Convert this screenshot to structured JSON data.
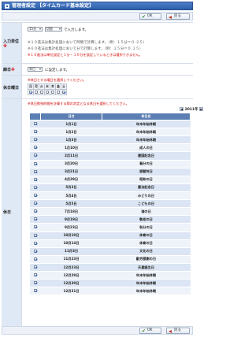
{
  "header": {
    "title": "管理者設定 【タイムカード基本設定】"
  },
  "toolbar": {
    "ok_label": "OK",
    "back_label": "戻る"
  },
  "input_unit": {
    "label": "入力単位",
    "hours_value": "15分",
    "method_value": "切捨",
    "suffix": "で入力します。",
    "note1": "※１０進法は集計処理において時間で計算します。（例：１５分＝０.２５）",
    "note2": "※６０進法は集計処理において分で計算します。（例：１５分＝０.１５）",
    "note3": "※１０進法は単位設定と１分・１０分を設定しているときは選択できません。"
  },
  "close_day": {
    "label": "締日",
    "value": "末日",
    "suffix": "に設定します。"
  },
  "holiday_dow": {
    "label": "休日曜日",
    "note": "※休日とする曜日を選択してください。",
    "days": [
      "日",
      "月",
      "火",
      "水",
      "木",
      "金",
      "土"
    ],
    "checked": [
      true,
      false,
      false,
      false,
      false,
      false,
      true
    ]
  },
  "holiday": {
    "label": "休日",
    "note": "※休日数残時間を計算する際の判定となる休日を選択してください。",
    "year": "2011年",
    "prev": "◀",
    "next": "▶",
    "columns": [
      "",
      "日付",
      "休日名"
    ],
    "rows": [
      {
        "date": "1月1日",
        "name": "年末年始休暇",
        "checked": true
      },
      {
        "date": "1月2日",
        "name": "年末年始休暇",
        "checked": true
      },
      {
        "date": "1月3日",
        "name": "年末年始休暇",
        "checked": true
      },
      {
        "date": "1月10日",
        "name": "成人の日",
        "checked": true
      },
      {
        "date": "2月11日",
        "name": "建国記念日",
        "checked": true
      },
      {
        "date": "3月20日",
        "name": "春分の日",
        "checked": true
      },
      {
        "date": "3月21日",
        "name": "振替休日",
        "checked": true
      },
      {
        "date": "4月29日",
        "name": "昭和の日",
        "checked": true
      },
      {
        "date": "5月3日",
        "name": "憲法記念日",
        "checked": true
      },
      {
        "date": "5月4日",
        "name": "みどりの日",
        "checked": true
      },
      {
        "date": "5月5日",
        "name": "こどもの日",
        "checked": true
      },
      {
        "date": "7月18日",
        "name": "海の日",
        "checked": true
      },
      {
        "date": "9月19日",
        "name": "敬老の日",
        "checked": true
      },
      {
        "date": "9月23日",
        "name": "秋分の日",
        "checked": true
      },
      {
        "date": "10月10日",
        "name": "体育の日",
        "checked": true
      },
      {
        "date": "10月14日",
        "name": "体育の日",
        "checked": true
      },
      {
        "date": "11月3日",
        "name": "文化の日",
        "checked": true
      },
      {
        "date": "11月23日",
        "name": "勤労感謝の日",
        "checked": true
      },
      {
        "date": "12月23日",
        "name": "天皇誕生日",
        "checked": true
      },
      {
        "date": "12月29日",
        "name": "年末年始休暇",
        "checked": true
      },
      {
        "date": "12月30日",
        "name": "年末年始休暇",
        "checked": true
      },
      {
        "date": "12月31日",
        "name": "年末年始休暇",
        "checked": true
      }
    ]
  }
}
